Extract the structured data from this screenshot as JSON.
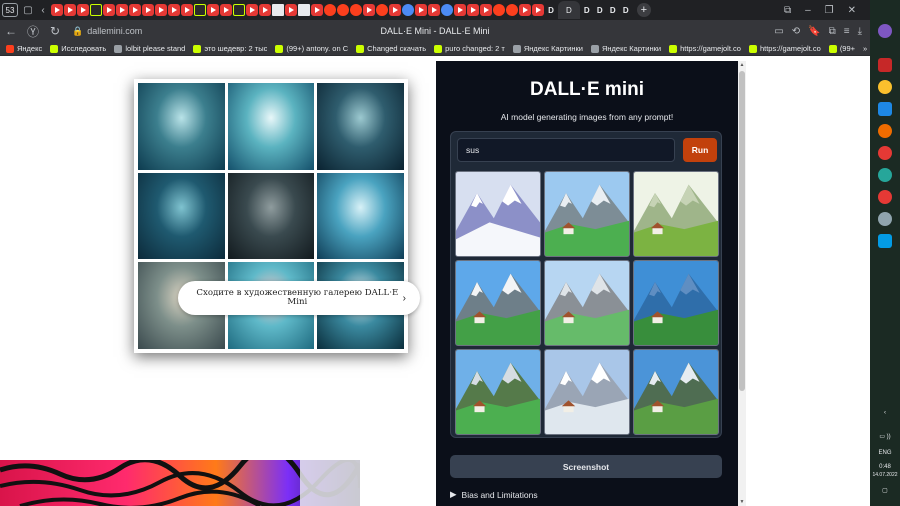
{
  "browser": {
    "tab_count": "53",
    "active_tab_title": "DALL·E Mini",
    "window_title": "DALL·E Mini - DALL·E Mini",
    "url": "dallemini.com",
    "bookmarks": [
      {
        "label": "Яндекс",
        "icon": "yandex-icon"
      },
      {
        "label": "Исследовать",
        "icon": "gamejolt-icon"
      },
      {
        "label": "lolbit please stand",
        "icon": "doc-icon"
      },
      {
        "label": "это шедевр: 2 тыс",
        "icon": "gamejolt-icon"
      },
      {
        "label": "(99+) antony. on C",
        "icon": "gamejolt-icon"
      },
      {
        "label": "Changed скачать",
        "icon": "gamejolt-icon"
      },
      {
        "label": "puro changed: 2 т",
        "icon": "gamejolt-icon"
      },
      {
        "label": "Яндекс Картинки",
        "icon": "doc-icon"
      },
      {
        "label": "Яндекс Картинки",
        "icon": "doc-icon"
      },
      {
        "label": "https://gamejolt.co",
        "icon": "gamejolt-icon"
      },
      {
        "label": "https://gamejolt.co",
        "icon": "gamejolt-icon"
      },
      {
        "label": "(99+",
        "icon": "gamejolt-icon"
      }
    ]
  },
  "gallery_link": {
    "text": "Сходите в художественную галерею DALL·E Mini"
  },
  "dalle": {
    "title": "DALL·E mini",
    "subtitle": "AI model generating images from any prompt!",
    "prompt_value": "sus",
    "run_label": "Run",
    "screenshot_label": "Screenshot",
    "bias_label": "Bias and Limitations"
  },
  "system": {
    "lang": "ENG",
    "time": "0:48",
    "date": "14.07.2022"
  },
  "colors": {
    "panel_bg": "#0b0f19",
    "run_button": "#c2410c",
    "taskbar": "#1b2a23"
  }
}
